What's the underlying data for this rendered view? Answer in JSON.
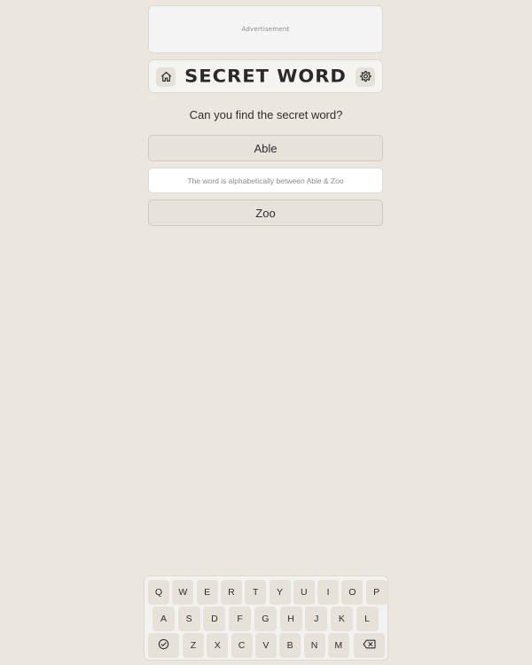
{
  "ad": {
    "label": "Advertisement"
  },
  "header": {
    "title": "SECRET WORD",
    "home_icon": "home-icon",
    "settings_icon": "gear-icon"
  },
  "game": {
    "question": "Can you find the secret word?",
    "lower_bound": "Able",
    "hint": "The word is alphabetically between Able & Zoo",
    "upper_bound": "Zoo"
  },
  "keyboard": {
    "row1": [
      "Q",
      "W",
      "E",
      "R",
      "T",
      "Y",
      "U",
      "I",
      "O",
      "P"
    ],
    "row2": [
      "A",
      "S",
      "D",
      "F",
      "G",
      "H",
      "J",
      "K",
      "L"
    ],
    "row3": [
      "Z",
      "X",
      "C",
      "V",
      "B",
      "N",
      "M"
    ],
    "submit_icon": "check-circle-icon",
    "backspace_icon": "backspace-icon"
  }
}
